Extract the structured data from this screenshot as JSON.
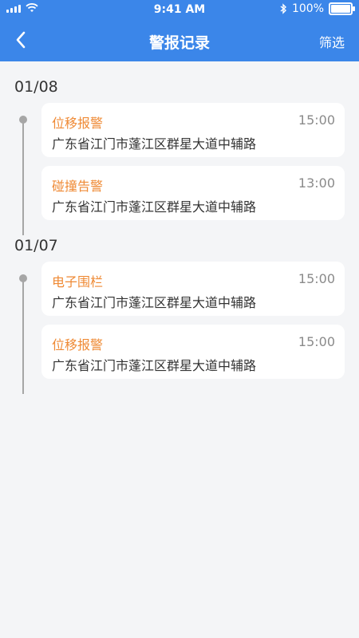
{
  "status_bar": {
    "time": "9:41 AM",
    "battery": "100%"
  },
  "nav": {
    "title": "警报记录",
    "filter_label": "筛选"
  },
  "groups": [
    {
      "date": "01/08",
      "items": [
        {
          "type": "位移报警",
          "time": "15:00",
          "address": "广东省江门市蓬江区群星大道中辅路"
        },
        {
          "type": "碰撞告警",
          "time": "13:00",
          "address": "广东省江门市蓬江区群星大道中辅路"
        }
      ]
    },
    {
      "date": "01/07",
      "items": [
        {
          "type": "电子围栏",
          "time": "15:00",
          "address": "广东省江门市蓬江区群星大道中辅路"
        },
        {
          "type": "位移报警",
          "time": "15:00",
          "address": "广东省江门市蓬江区群星大道中辅路"
        }
      ]
    }
  ],
  "colors": {
    "header": "#3b86e9",
    "alert_type": "#ef8a35",
    "background": "#f4f5f7"
  }
}
